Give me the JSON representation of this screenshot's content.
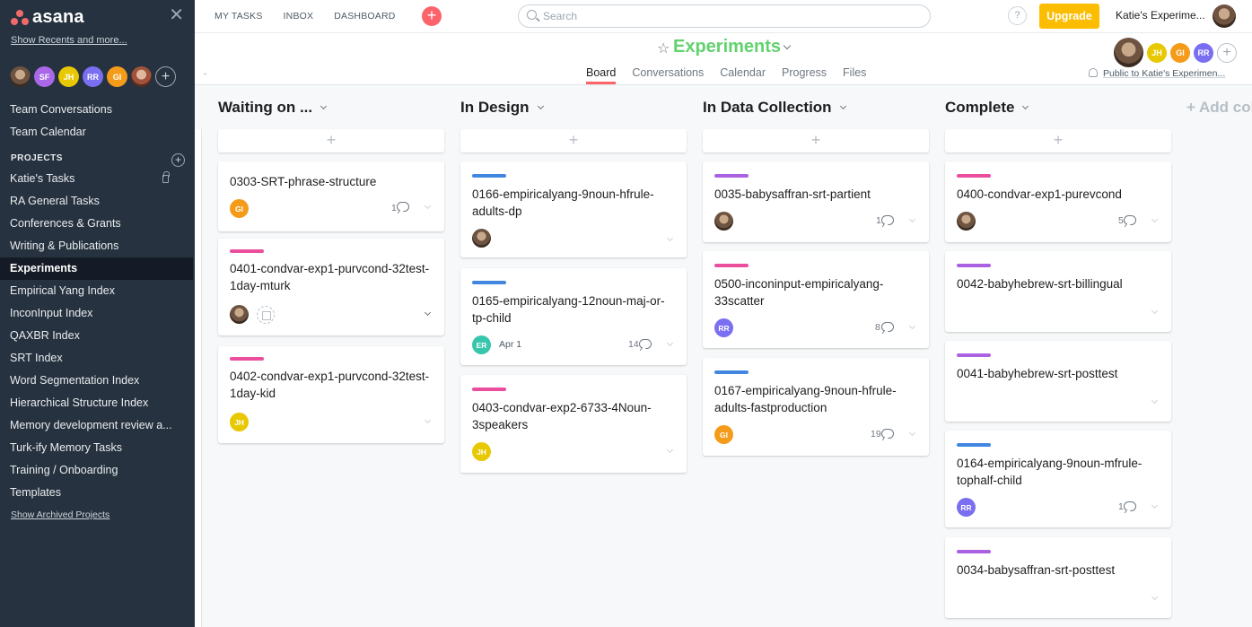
{
  "app": {
    "logo_text": "asana"
  },
  "sidebar": {
    "show_recents": "Show Recents and more...",
    "avatars": [
      {
        "initials": "",
        "type": "photo"
      },
      {
        "initials": "SF",
        "color": "#a968e8"
      },
      {
        "initials": "JH",
        "color": "#e8c800"
      },
      {
        "initials": "RR",
        "color": "#7a6ff0"
      },
      {
        "initials": "GI",
        "color": "#f49c1a"
      },
      {
        "initials": "",
        "type": "photo"
      }
    ],
    "links": [
      "Team Conversations",
      "Team Calendar"
    ],
    "projects_heading": "PROJECTS",
    "projects": [
      {
        "label": "Katie's Tasks",
        "locked": true
      },
      {
        "label": "RA General Tasks"
      },
      {
        "label": "Conferences & Grants"
      },
      {
        "label": "Writing & Publications"
      },
      {
        "label": "Experiments",
        "active": true
      },
      {
        "label": "Empirical Yang Index"
      },
      {
        "label": "InconInput Index"
      },
      {
        "label": "QAXBR Index"
      },
      {
        "label": "SRT Index"
      },
      {
        "label": "Word Segmentation Index"
      },
      {
        "label": "Hierarchical Structure Index"
      },
      {
        "label": "Memory development review a..."
      },
      {
        "label": "Turk-ify Memory Tasks"
      },
      {
        "label": "Training / Onboarding"
      },
      {
        "label": "Templates"
      }
    ],
    "show_archived": "Show Archived Projects"
  },
  "topbar": {
    "nav": [
      "MY TASKS",
      "INBOX",
      "DASHBOARD"
    ],
    "search_placeholder": "Search",
    "help": "?",
    "upgrade": "Upgrade",
    "org_name": "Katie's Experime..."
  },
  "project": {
    "title": "Experiments",
    "tabs": [
      "Board",
      "Conversations",
      "Calendar",
      "Progress",
      "Files"
    ],
    "active_tab": "Board",
    "members": [
      {
        "initials": "JH",
        "color": "#e8c800"
      },
      {
        "initials": "GI",
        "color": "#f49c1a"
      },
      {
        "initials": "RR",
        "color": "#7a6ff0"
      }
    ],
    "privacy": "Public to Katie's Experimen..."
  },
  "board": {
    "add_column": "+ Add col",
    "columns": [
      {
        "title": "Waiting on ...",
        "cards": [
          {
            "title": "0303-SRT-phrase-structure",
            "assignee": "GI",
            "assignee_color": "#f49c1a",
            "comments": "1"
          },
          {
            "title": "0401-condvar-exp1-purvcond-32test-1day-mturk",
            "tag": "#ea4e9d",
            "assignee": "photo"
          },
          {
            "title": "0402-condvar-exp1-purvcond-32test-1day-kid",
            "tag": "#ea4e9d",
            "assignee": "JH",
            "assignee_color": "#e8c800"
          }
        ]
      },
      {
        "title": "In Design",
        "cards": [
          {
            "title": "0166-empiricalyang-9noun-hfrule-adults-dp",
            "tag": "#4186e0",
            "assignee": "photo"
          },
          {
            "title": "0165-empiricalyang-12noun-maj-or-tp-child",
            "tag": "#4186e0",
            "assignee": "ER",
            "assignee_color": "#37c5ab",
            "due": "Apr 1",
            "comments": "14"
          },
          {
            "title": "0403-condvar-exp2-6733-4Noun-3speakers",
            "tag": "#ea4e9d",
            "assignee": "JH",
            "assignee_color": "#e8c800"
          }
        ]
      },
      {
        "title": "In Data Collection",
        "cards": [
          {
            "title": "0035-babysaffran-srt-partient",
            "tag": "#aa62e3",
            "assignee": "photo",
            "comments": "1"
          },
          {
            "title": "0500-inconinput-empiricalyang-33scatter",
            "tag": "#ea4e9d",
            "assignee": "RR",
            "assignee_color": "#7a6ff0",
            "comments": "8"
          },
          {
            "title": "0167-empiricalyang-9noun-hfrule-adults-fastproduction",
            "tag": "#4186e0",
            "assignee": "GI",
            "assignee_color": "#f49c1a",
            "comments": "19"
          }
        ]
      },
      {
        "title": "Complete",
        "cards": [
          {
            "title": "0400-condvar-exp1-purevcond",
            "tag": "#ea4e9d",
            "assignee": "photo",
            "comments": "5"
          },
          {
            "title": "0042-babyhebrew-srt-billingual",
            "tag": "#aa62e3"
          },
          {
            "title": "0041-babyhebrew-srt-posttest",
            "tag": "#aa62e3"
          },
          {
            "title": "0164-empiricalyang-9noun-mfrule-tophalf-child",
            "tag": "#4186e0",
            "assignee": "RR",
            "assignee_color": "#7a6ff0",
            "comments": "1"
          },
          {
            "title": "0034-babysaffran-srt-posttest",
            "tag": "#aa62e3"
          }
        ]
      }
    ]
  }
}
